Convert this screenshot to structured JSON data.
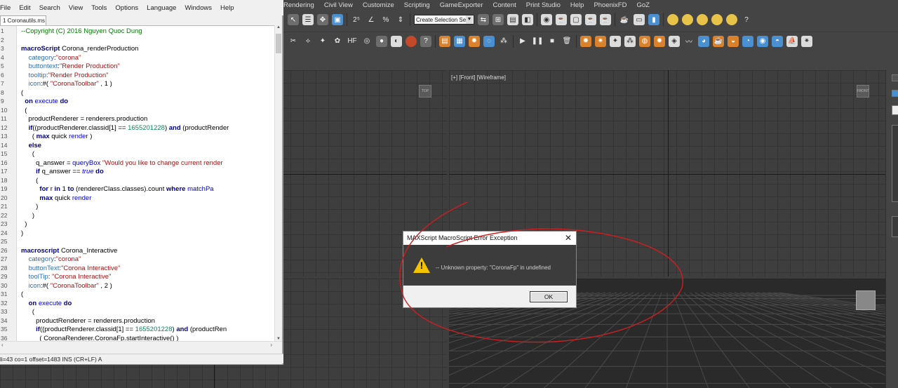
{
  "max_menu": [
    "Rendering",
    "Civil View",
    "Customize",
    "Scripting",
    "GameExporter",
    "Content",
    "Print Studio",
    "Help",
    "PhoenixFD",
    "GoZ"
  ],
  "toolbar": {
    "selection_set": "Create Selection Se"
  },
  "viewports": {
    "front_label": "[+] [Front] [Wireframe]",
    "top_cube": "TOP",
    "front_cube": "FRONT"
  },
  "editor": {
    "menu": [
      "File",
      "Edit",
      "Search",
      "View",
      "Tools",
      "Options",
      "Language",
      "Windows",
      "Help"
    ],
    "tab": "1 Coronautils.ms",
    "status": "li=43 co=1 offset=1483 INS (CR+LF) A",
    "line_numbers": [
      "1",
      "2",
      "3",
      "4",
      "5",
      "6",
      "7",
      "8",
      "9",
      "10",
      "11",
      "12",
      "13",
      "14",
      "15",
      "16",
      "17",
      "18",
      "19",
      "20",
      "21",
      "22",
      "23",
      "24",
      "25",
      "26",
      "27",
      "28",
      "29",
      "30",
      "31",
      "32",
      "33",
      "34",
      "35",
      "36"
    ],
    "lines": [
      "--Copyright (C) 2016 Nguyen Quoc Dung",
      "",
      "macroScript Corona_renderProduction",
      "    category:\"corona\"",
      "    buttontext:\"Render Production\"",
      "    tooltip:\"Render Production\"",
      "    icon:#( \"CoronaToolbar\" , 1 )",
      "(",
      "  on execute do",
      "  (",
      "    productRenderer = renderers.production",
      "    if((productRenderer.classid[1] == 1655201228) and (productRender",
      "      ( max quick render )",
      "    else",
      "      (",
      "        q_answer = queryBox \"Would you like to change current render",
      "        if q_answer == true do",
      "        (",
      "          for r in 1 to (rendererClass.classes).count where matchPa",
      "          max quick render",
      "        )",
      "      )",
      "  )",
      ")",
      "",
      "macroscript Corona_Interactive",
      "    category:\"corona\"",
      "    buttonText:\"Corona Interactive\"",
      "    toolTip: \"Corona Interactive\"",
      "    icon:#( \"CoronaToolbar\" , 2 )",
      "(",
      "    on execute do",
      "      (",
      "        productRenderer = renderers.production",
      "        if((productRenderer.classid[1] == 1655201228) and (productRen",
      "          ( CoronaRenderer.CoronaFp.startInteractive() )"
    ]
  },
  "dialog": {
    "title": "MAXScript MacroScript Error Exception",
    "message": "-- Unknown property: \"CoronaFp\" in undefined",
    "ok": "OK"
  },
  "colors": {
    "annotation": "#cc1f1f",
    "warning": "#f5c400"
  }
}
